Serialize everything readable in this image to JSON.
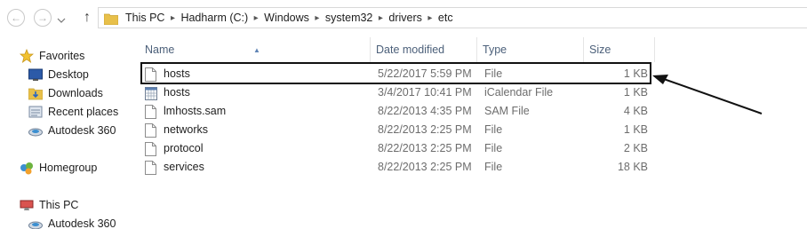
{
  "toolbar": {
    "back_icon": "arrow-left-icon",
    "forward_icon": "arrow-right-icon",
    "up_icon": "arrow-up-icon",
    "breadcrumb": [
      "This PC",
      "Hadharm (C:)",
      "Windows",
      "system32",
      "drivers",
      "etc"
    ]
  },
  "sidebar": {
    "favorites_label": "Favorites",
    "favorites": [
      {
        "label": "Desktop",
        "icon": "desktop-icon"
      },
      {
        "label": "Downloads",
        "icon": "downloads-icon"
      },
      {
        "label": "Recent places",
        "icon": "recent-places-icon"
      },
      {
        "label": "Autodesk 360",
        "icon": "cloud-icon"
      }
    ],
    "homegroup_label": "Homegroup",
    "thispc_label": "This PC",
    "thispc_children": [
      {
        "label": "Autodesk 360",
        "icon": "cloud-icon"
      }
    ]
  },
  "columns": {
    "name": "Name",
    "date": "Date modified",
    "type": "Type",
    "size": "Size"
  },
  "files": [
    {
      "name": "hosts",
      "date": "5/22/2017 5:59 PM",
      "type": "File",
      "size": "1 KB",
      "icon": "file-icon"
    },
    {
      "name": "hosts",
      "date": "3/4/2017 10:41 PM",
      "type": "iCalendar File",
      "size": "1 KB",
      "icon": "calendar-file-icon"
    },
    {
      "name": "lmhosts.sam",
      "date": "8/22/2013 4:35 PM",
      "type": "SAM File",
      "size": "4 KB",
      "icon": "file-icon"
    },
    {
      "name": "networks",
      "date": "8/22/2013 2:25 PM",
      "type": "File",
      "size": "1 KB",
      "icon": "file-icon"
    },
    {
      "name": "protocol",
      "date": "8/22/2013 2:25 PM",
      "type": "File",
      "size": "2 KB",
      "icon": "file-icon"
    },
    {
      "name": "services",
      "date": "8/22/2013 2:25 PM",
      "type": "File",
      "size": "18 KB",
      "icon": "file-icon"
    }
  ],
  "colors": {
    "header_text": "#4c607a",
    "meta_text": "#6d6d6d",
    "highlight_border": "#111111"
  }
}
